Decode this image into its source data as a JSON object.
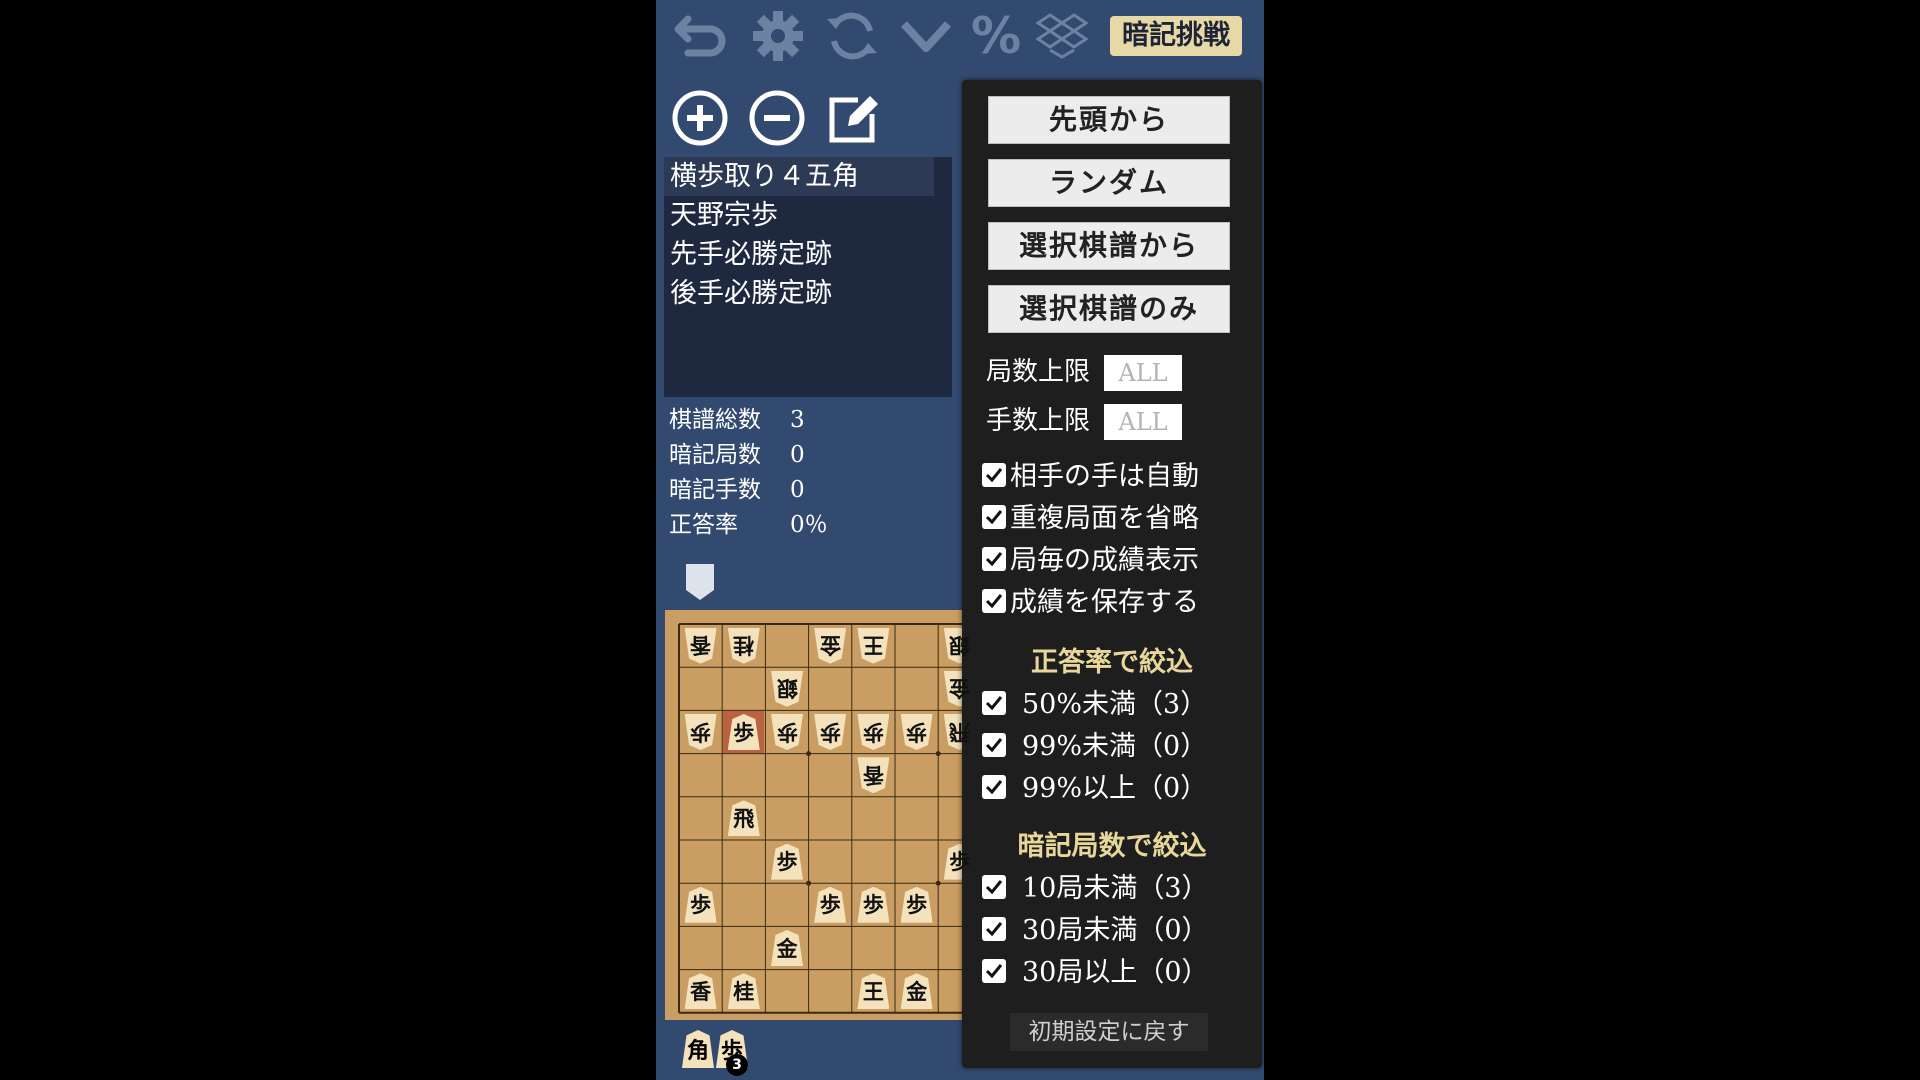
{
  "toolbar": {
    "icons": [
      "undo-icon",
      "gear-icon",
      "refresh-icon",
      "check-icon",
      "percent-icon",
      "dropbox-icon"
    ],
    "percent_label": "%",
    "challenge_label": "暗記挑戦",
    "icon_color": "#6d82a2"
  },
  "list_controls": {
    "icons": [
      "add-circle-icon",
      "remove-circle-icon",
      "edit-icon"
    ]
  },
  "kifu_list": {
    "items": [
      "横歩取り４五角",
      "天野宗歩",
      "先手必勝定跡",
      "後手必勝定跡"
    ],
    "selected_index": 0
  },
  "stats": [
    {
      "label": "棋譜総数",
      "value": "3"
    },
    {
      "label": "暗記局数",
      "value": "0"
    },
    {
      "label": "暗記手数",
      "value": "0"
    },
    {
      "label": "正答率",
      "value": "0％"
    }
  ],
  "board": {
    "pieces": [
      {
        "col": 0,
        "row": 0,
        "char": "香",
        "owner": "gote"
      },
      {
        "col": 1,
        "row": 0,
        "char": "桂",
        "owner": "gote"
      },
      {
        "col": 3,
        "row": 0,
        "char": "金",
        "owner": "gote"
      },
      {
        "col": 4,
        "row": 0,
        "char": "王",
        "owner": "gote"
      },
      {
        "col": 6,
        "row": 0,
        "char": "銀",
        "owner": "gote"
      },
      {
        "col": 2,
        "row": 1,
        "char": "銀",
        "owner": "gote"
      },
      {
        "col": 6,
        "row": 1,
        "char": "金",
        "owner": "gote"
      },
      {
        "col": 0,
        "row": 2,
        "char": "歩",
        "owner": "gote"
      },
      {
        "col": 1,
        "row": 2,
        "char": "歩",
        "owner": "sente"
      },
      {
        "col": 2,
        "row": 2,
        "char": "歩",
        "owner": "gote"
      },
      {
        "col": 3,
        "row": 2,
        "char": "歩",
        "owner": "gote"
      },
      {
        "col": 4,
        "row": 2,
        "char": "歩",
        "owner": "gote"
      },
      {
        "col": 5,
        "row": 2,
        "char": "歩",
        "owner": "gote"
      },
      {
        "col": 6,
        "row": 2,
        "char": "飛",
        "owner": "gote"
      },
      {
        "col": 4,
        "row": 3,
        "char": "香",
        "owner": "gote"
      },
      {
        "col": 1,
        "row": 4,
        "char": "飛",
        "owner": "sente"
      },
      {
        "col": 2,
        "row": 5,
        "char": "歩",
        "owner": "sente"
      },
      {
        "col": 6,
        "row": 5,
        "char": "歩",
        "owner": "sente"
      },
      {
        "col": 0,
        "row": 6,
        "char": "歩",
        "owner": "sente"
      },
      {
        "col": 3,
        "row": 6,
        "char": "歩",
        "owner": "sente"
      },
      {
        "col": 4,
        "row": 6,
        "char": "歩",
        "owner": "sente"
      },
      {
        "col": 5,
        "row": 6,
        "char": "歩",
        "owner": "sente"
      },
      {
        "col": 2,
        "row": 7,
        "char": "金",
        "owner": "sente"
      },
      {
        "col": 0,
        "row": 8,
        "char": "香",
        "owner": "sente"
      },
      {
        "col": 1,
        "row": 8,
        "char": "桂",
        "owner": "sente"
      },
      {
        "col": 4,
        "row": 8,
        "char": "王",
        "owner": "sente"
      },
      {
        "col": 5,
        "row": 8,
        "char": "金",
        "owner": "sente"
      }
    ],
    "last_move": {
      "col": 1,
      "row": 2
    }
  },
  "hand": {
    "pieces": [
      "角",
      "歩"
    ],
    "pawn_count": "3"
  },
  "panel": {
    "buttons": [
      "先頭から",
      "ランダム",
      "選択棋譜から",
      "選択棋譜のみ"
    ],
    "limits": [
      {
        "label": "局数上限",
        "value": "ALL"
      },
      {
        "label": "手数上限",
        "value": "ALL"
      }
    ],
    "options": [
      {
        "label": "相手の手は自動",
        "checked": true
      },
      {
        "label": "重複局面を省略",
        "checked": true
      },
      {
        "label": "局毎の成績表示",
        "checked": true
      },
      {
        "label": "成績を保存する",
        "checked": true
      }
    ],
    "accuracy_filter": {
      "title": "正答率で絞込",
      "items": [
        {
          "label": "50%未満（3）",
          "checked": true
        },
        {
          "label": "99%未満（0）",
          "checked": true
        },
        {
          "label": "99%以上（0）",
          "checked": true
        }
      ]
    },
    "memorized_filter": {
      "title": "暗記局数で絞込",
      "items": [
        {
          "label": "10局未満（3）",
          "checked": true
        },
        {
          "label": "30局未満（0）",
          "checked": true
        },
        {
          "label": "30局以上（0）",
          "checked": true
        }
      ]
    },
    "reset_label": "初期設定に戻す"
  },
  "colors": {
    "background": "#334a70",
    "board": "#ca9e62",
    "panel": "#1e1e1e",
    "accent": "#e8d79a"
  }
}
